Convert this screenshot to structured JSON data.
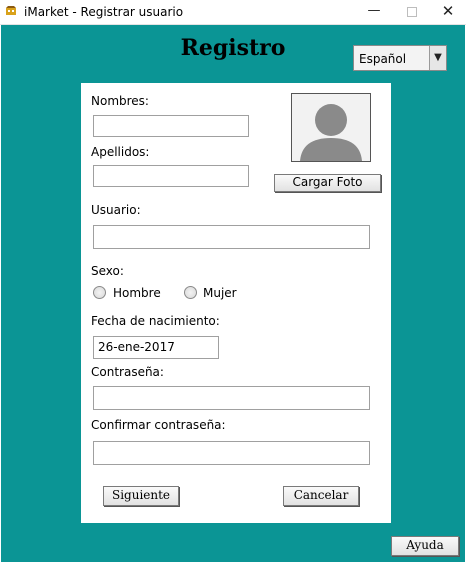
{
  "window": {
    "title": "iMarket - Registrar usuario",
    "minimize_glyph": "—",
    "close_glyph": "✕",
    "icon": "app-icon"
  },
  "header": {
    "title": "Registro"
  },
  "language": {
    "selected": "Español",
    "arrow": "▼"
  },
  "form": {
    "nombres_label": "Nombres:",
    "nombres_value": "",
    "apellidos_label": "Apellidos:",
    "apellidos_value": "",
    "usuario_label": "Usuario:",
    "usuario_value": "",
    "sexo_label": "Sexo:",
    "sexo_options": [
      "Hombre",
      "Mujer"
    ],
    "fecha_label": "Fecha de nacimiento:",
    "fecha_value": "26-ene-2017",
    "password_label": "Contraseña:",
    "password_value": "",
    "confirm_label": "Confirmar contraseña:",
    "confirm_value": ""
  },
  "photo": {
    "upload_label": "Cargar Foto",
    "icon": "avatar-placeholder-icon"
  },
  "buttons": {
    "next": "Siguiente",
    "cancel": "Cancelar",
    "help": "Ayuda"
  },
  "colors": {
    "background": "#0b9595",
    "panel": "#ffffff"
  }
}
